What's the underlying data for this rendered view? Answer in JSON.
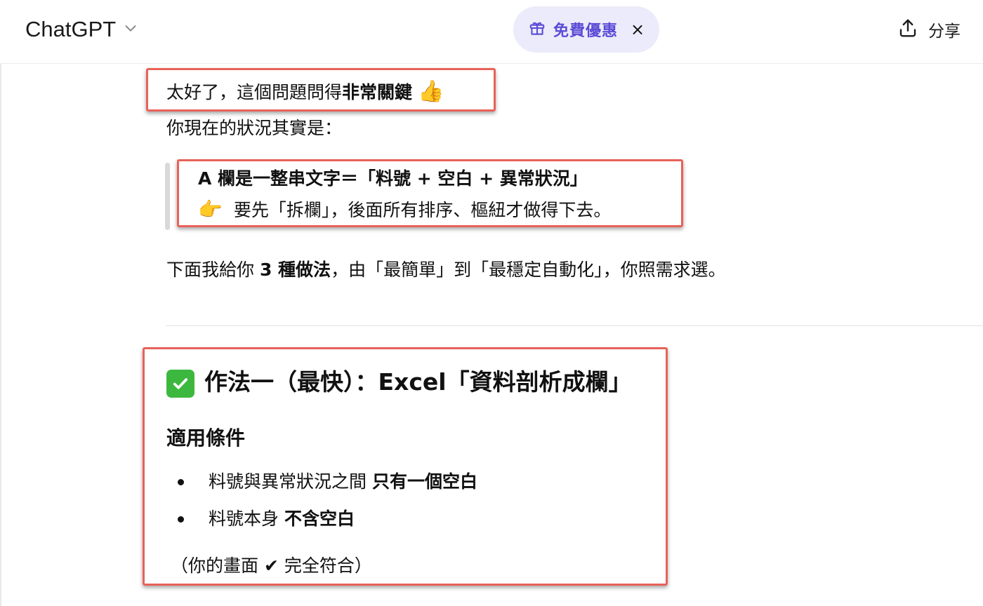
{
  "header": {
    "model_name": "ChatGPT",
    "promo_label": "免費優惠",
    "promo_close": "×",
    "share_label": "分享"
  },
  "message": {
    "intro_prefix": "太好了，這個問題問得",
    "intro_bold": "非常關鍵",
    "intro_emoji": "👍",
    "status_line": "你現在的狀況其實是：",
    "quote_line1": "A 欄是一整串文字＝「料號 + 空白 + 異常狀況」",
    "quote_emoji": "👉",
    "quote_line2": "要先「拆欄」，後面所有排序、樞紐才做得下去。",
    "methods_prefix": "下面我給你 ",
    "methods_bold": "3 種做法",
    "methods_suffix": "，由「最簡單」到「最穩定自動化」，你照需求選。"
  },
  "method1": {
    "title": "作法一（最快）：Excel「資料剖析成欄」",
    "conditions_heading": "適用條件",
    "bullets": [
      {
        "text": "料號與異常狀況之間 ",
        "bold": "只有一個空白"
      },
      {
        "text": "料號本身 ",
        "bold": "不含空白"
      }
    ],
    "note": "（你的畫面 ✔ 完全符合）"
  },
  "colors": {
    "highlight_border": "#e8625a",
    "promo_bg": "#ebebfb",
    "promo_text": "#5b4bd6",
    "check_green": "#3db83f"
  },
  "icons": {
    "model_dropdown": "chevron-down-icon",
    "promo": "gift-icon",
    "share": "share-upload-icon",
    "check": "check-mark-icon"
  }
}
